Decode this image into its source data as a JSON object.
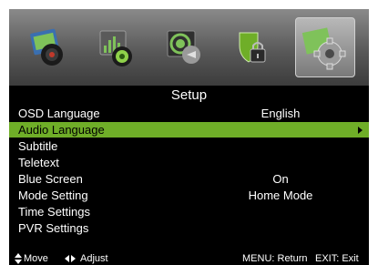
{
  "menu": {
    "title": "Setup",
    "tabs": [
      {
        "icon": "picture-icon"
      },
      {
        "icon": "sound-icon"
      },
      {
        "icon": "channel-icon"
      },
      {
        "icon": "lock-icon"
      },
      {
        "icon": "gear-icon",
        "selected": true
      }
    ],
    "rows": [
      {
        "label": "OSD Language",
        "value": "English"
      },
      {
        "label": "Audio Language",
        "value": "",
        "selected": true
      },
      {
        "label": "Subtitle",
        "value": ""
      },
      {
        "label": "Teletext",
        "value": ""
      },
      {
        "label": "Blue Screen",
        "value": "On"
      },
      {
        "label": "Mode Setting",
        "value": "Home Mode"
      },
      {
        "label": "Time Settings",
        "value": ""
      },
      {
        "label": "PVR Settings",
        "value": ""
      }
    ]
  },
  "footer": {
    "move": "Move",
    "adjust": "Adjust",
    "menu_return": "MENU: Return",
    "exit_exit": "EXIT: Exit"
  },
  "colors": {
    "highlight": "#6fae28",
    "menu_bg": "#000000",
    "bar_top": "#8a8a8a",
    "bar_bottom": "#3c3c3c"
  }
}
